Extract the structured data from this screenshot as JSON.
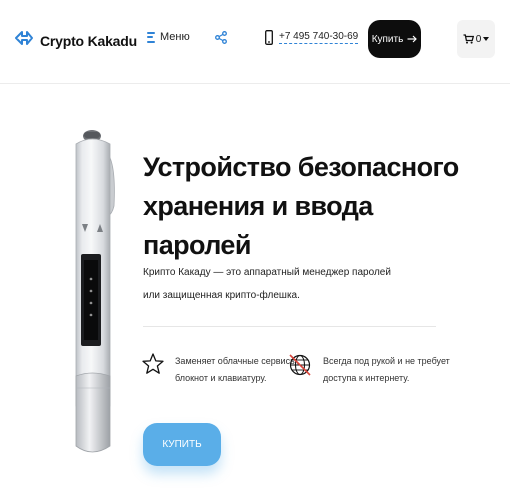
{
  "header": {
    "logo_text": "Crypto Kakadu",
    "menu_label": "Меню",
    "phone": "+7 495 740-30-69",
    "buy_label": "Купить",
    "cart_count": "0"
  },
  "hero": {
    "title_line1": "Устройство безопасного",
    "title_line2": "хранения и ввода паролей",
    "desc_line1": "Крипто Какаду — это аппаратный менеджер паролей",
    "desc_line2": "или защищенная крипто-флешка.",
    "features": [
      {
        "icon": "star-icon",
        "line1": "Заменяет облачные сервисы,",
        "line2": "блокнот и клавиатуру."
      },
      {
        "icon": "globe-crossed-icon",
        "line1": "Всегда под рукой и не требует",
        "line2": "доступа к интернету."
      }
    ],
    "buy_label": "КУПИТЬ"
  },
  "colors": {
    "accent_blue": "#5aaee8",
    "link_blue": "#2f83d6",
    "button_dark": "#0d0d0d",
    "cross_red": "#d9453b"
  }
}
